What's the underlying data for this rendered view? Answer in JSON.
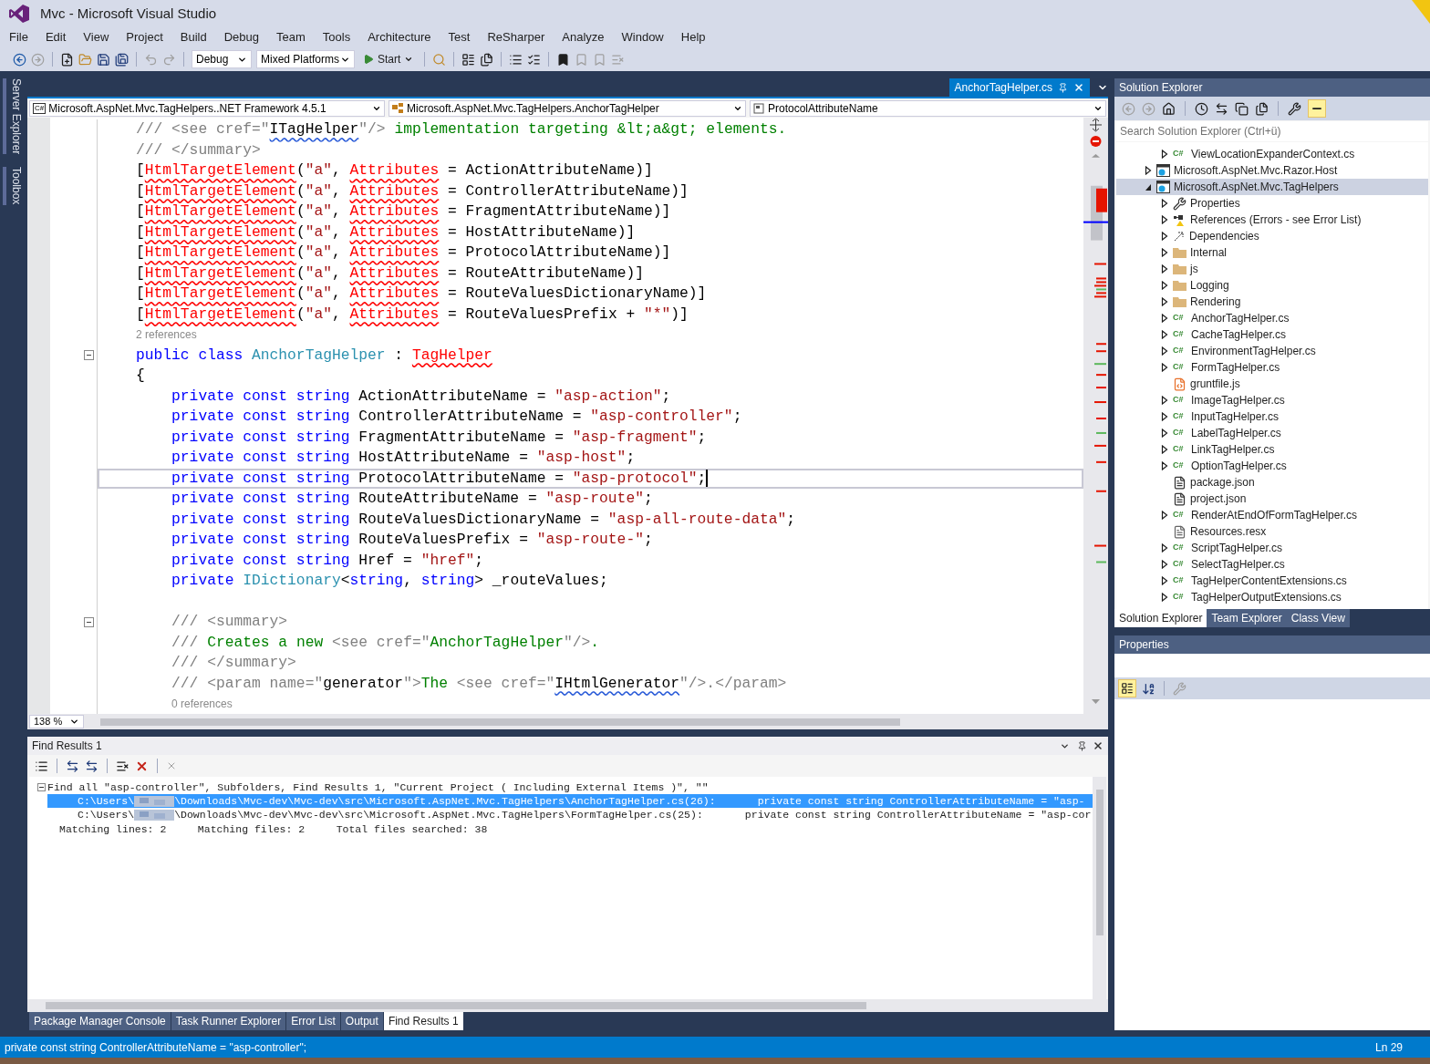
{
  "window": {
    "title": "Mvc - Microsoft Visual Studio"
  },
  "menu": [
    "File",
    "Edit",
    "View",
    "Project",
    "Build",
    "Debug",
    "Team",
    "Tools",
    "Architecture",
    "Test",
    "ReSharper",
    "Analyze",
    "Window",
    "Help"
  ],
  "toolbar": {
    "configuration": "Debug",
    "platform": "Mixed Platforms",
    "start": "Start"
  },
  "side_tabs": [
    "Server Explorer",
    "Toolbox"
  ],
  "editor": {
    "tabs": [
      {
        "label": "AnchorTagHelper.cs",
        "selected": true
      }
    ],
    "nav": {
      "badge": "C#",
      "project": "Microsoft.AspNet.Mvc.TagHelpers..NET Framework 4.5.1",
      "type": "Microsoft.AspNet.Mvc.TagHelpers.AnchorTagHelper",
      "member": "ProtocolAttributeName"
    },
    "lines": [
      {
        "current": false,
        "fold": false,
        "tokens": [
          {
            "text": "/// <see cref=\"",
            "kind": "doc"
          },
          {
            "text": "ITagHelper",
            "kind": "sq"
          },
          {
            "text": "\"/> ",
            "kind": "doc"
          },
          {
            "text": "implementation targeting &lt;a&gt; elements.",
            "kind": "cm"
          }
        ]
      },
      {
        "current": false,
        "fold": false,
        "tokens": [
          {
            "text": "/// </summary>",
            "kind": "doc"
          }
        ]
      },
      {
        "current": false,
        "fold": false,
        "tokens": [
          {
            "text": "[",
            "kind": "pl"
          },
          {
            "text": "HtmlTargetElement",
            "kind": "err"
          },
          {
            "text": "(",
            "kind": "pl"
          },
          {
            "text": "\"a\"",
            "kind": "str"
          },
          {
            "text": ", ",
            "kind": "pl"
          },
          {
            "text": "Attributes",
            "kind": "err"
          },
          {
            "text": " = ActionAttributeName)]",
            "kind": "pl"
          }
        ]
      },
      {
        "current": false,
        "fold": false,
        "tokens": [
          {
            "text": "[",
            "kind": "pl"
          },
          {
            "text": "HtmlTargetElement",
            "kind": "err"
          },
          {
            "text": "(",
            "kind": "pl"
          },
          {
            "text": "\"a\"",
            "kind": "str"
          },
          {
            "text": ", ",
            "kind": "pl"
          },
          {
            "text": "Attributes",
            "kind": "err"
          },
          {
            "text": " = ControllerAttributeName)]",
            "kind": "pl"
          }
        ]
      },
      {
        "current": false,
        "fold": false,
        "tokens": [
          {
            "text": "[",
            "kind": "pl"
          },
          {
            "text": "HtmlTargetElement",
            "kind": "err"
          },
          {
            "text": "(",
            "kind": "pl"
          },
          {
            "text": "\"a\"",
            "kind": "str"
          },
          {
            "text": ", ",
            "kind": "pl"
          },
          {
            "text": "Attributes",
            "kind": "err"
          },
          {
            "text": " = FragmentAttributeName)]",
            "kind": "pl"
          }
        ]
      },
      {
        "current": false,
        "fold": false,
        "tokens": [
          {
            "text": "[",
            "kind": "pl"
          },
          {
            "text": "HtmlTargetElement",
            "kind": "err"
          },
          {
            "text": "(",
            "kind": "pl"
          },
          {
            "text": "\"a\"",
            "kind": "str"
          },
          {
            "text": ", ",
            "kind": "pl"
          },
          {
            "text": "Attributes",
            "kind": "err"
          },
          {
            "text": " = HostAttributeName)]",
            "kind": "pl"
          }
        ]
      },
      {
        "current": false,
        "fold": false,
        "tokens": [
          {
            "text": "[",
            "kind": "pl"
          },
          {
            "text": "HtmlTargetElement",
            "kind": "err"
          },
          {
            "text": "(",
            "kind": "pl"
          },
          {
            "text": "\"a\"",
            "kind": "str"
          },
          {
            "text": ", ",
            "kind": "pl"
          },
          {
            "text": "Attributes",
            "kind": "err"
          },
          {
            "text": " = ProtocolAttributeName)]",
            "kind": "pl"
          }
        ]
      },
      {
        "current": false,
        "fold": false,
        "tokens": [
          {
            "text": "[",
            "kind": "pl"
          },
          {
            "text": "HtmlTargetElement",
            "kind": "err"
          },
          {
            "text": "(",
            "kind": "pl"
          },
          {
            "text": "\"a\"",
            "kind": "str"
          },
          {
            "text": ", ",
            "kind": "pl"
          },
          {
            "text": "Attributes",
            "kind": "err"
          },
          {
            "text": " = RouteAttributeName)]",
            "kind": "pl"
          }
        ]
      },
      {
        "current": false,
        "fold": false,
        "tokens": [
          {
            "text": "[",
            "kind": "pl"
          },
          {
            "text": "HtmlTargetElement",
            "kind": "err"
          },
          {
            "text": "(",
            "kind": "pl"
          },
          {
            "text": "\"a\"",
            "kind": "str"
          },
          {
            "text": ", ",
            "kind": "pl"
          },
          {
            "text": "Attributes",
            "kind": "err"
          },
          {
            "text": " = RouteValuesDictionaryName)]",
            "kind": "pl"
          }
        ]
      },
      {
        "current": false,
        "fold": false,
        "tokens": [
          {
            "text": "[",
            "kind": "pl"
          },
          {
            "text": "HtmlTargetElement",
            "kind": "err"
          },
          {
            "text": "(",
            "kind": "pl"
          },
          {
            "text": "\"a\"",
            "kind": "str"
          },
          {
            "text": ", ",
            "kind": "pl"
          },
          {
            "text": "Attributes",
            "kind": "err"
          },
          {
            "text": " = RouteValuesPrefix + ",
            "kind": "pl"
          },
          {
            "text": "\"*\"",
            "kind": "str"
          },
          {
            "text": ")]",
            "kind": "pl"
          }
        ]
      },
      {
        "current": false,
        "fold": false,
        "tokens": [
          {
            "text": "2 references",
            "kind": "lens"
          }
        ]
      },
      {
        "current": false,
        "fold": true,
        "tokens": [
          {
            "text": "public class ",
            "kind": "kw"
          },
          {
            "text": "AnchorTagHelper",
            "kind": "type"
          },
          {
            "text": " : ",
            "kind": "pl"
          },
          {
            "text": "TagHelper",
            "kind": "err"
          }
        ]
      },
      {
        "current": false,
        "fold": false,
        "tokens": [
          {
            "text": "{",
            "kind": "pl"
          }
        ]
      },
      {
        "current": false,
        "fold": false,
        "tokens": [
          {
            "text": "    private const string",
            "kind": "kw"
          },
          {
            "text": " ActionAttributeName = ",
            "kind": "pl"
          },
          {
            "text": "\"asp-action\"",
            "kind": "str"
          },
          {
            "text": ";",
            "kind": "pl"
          }
        ]
      },
      {
        "current": false,
        "fold": false,
        "tokens": [
          {
            "text": "    private const string",
            "kind": "kw"
          },
          {
            "text": " ControllerAttributeName = ",
            "kind": "pl"
          },
          {
            "text": "\"asp-controller\"",
            "kind": "str"
          },
          {
            "text": ";",
            "kind": "pl"
          }
        ]
      },
      {
        "current": false,
        "fold": false,
        "tokens": [
          {
            "text": "    private const string",
            "kind": "kw"
          },
          {
            "text": " FragmentAttributeName = ",
            "kind": "pl"
          },
          {
            "text": "\"asp-fragment\"",
            "kind": "str"
          },
          {
            "text": ";",
            "kind": "pl"
          }
        ]
      },
      {
        "current": false,
        "fold": false,
        "tokens": [
          {
            "text": "    private const string",
            "kind": "kw"
          },
          {
            "text": " HostAttributeName = ",
            "kind": "pl"
          },
          {
            "text": "\"asp-host\"",
            "kind": "str"
          },
          {
            "text": ";",
            "kind": "pl"
          }
        ]
      },
      {
        "current": true,
        "fold": false,
        "tokens": [
          {
            "text": "    private const string",
            "kind": "kw"
          },
          {
            "text": " ProtocolAttributeName = ",
            "kind": "pl"
          },
          {
            "text": "\"asp-protocol\"",
            "kind": "str"
          },
          {
            "text": ";",
            "kind": "pl"
          }
        ]
      },
      {
        "current": false,
        "fold": false,
        "tokens": [
          {
            "text": "    private const string",
            "kind": "kw"
          },
          {
            "text": " RouteAttributeName = ",
            "kind": "pl"
          },
          {
            "text": "\"asp-route\"",
            "kind": "str"
          },
          {
            "text": ";",
            "kind": "pl"
          }
        ]
      },
      {
        "current": false,
        "fold": false,
        "tokens": [
          {
            "text": "    private const string",
            "kind": "kw"
          },
          {
            "text": " RouteValuesDictionaryName = ",
            "kind": "pl"
          },
          {
            "text": "\"asp-all-route-data\"",
            "kind": "str"
          },
          {
            "text": ";",
            "kind": "pl"
          }
        ]
      },
      {
        "current": false,
        "fold": false,
        "tokens": [
          {
            "text": "    private const string",
            "kind": "kw"
          },
          {
            "text": " RouteValuesPrefix = ",
            "kind": "pl"
          },
          {
            "text": "\"asp-route-\"",
            "kind": "str"
          },
          {
            "text": ";",
            "kind": "pl"
          }
        ]
      },
      {
        "current": false,
        "fold": false,
        "tokens": [
          {
            "text": "    private const string",
            "kind": "kw"
          },
          {
            "text": " Href = ",
            "kind": "pl"
          },
          {
            "text": "\"href\"",
            "kind": "str"
          },
          {
            "text": ";",
            "kind": "pl"
          }
        ]
      },
      {
        "current": false,
        "fold": false,
        "tokens": [
          {
            "text": "    private ",
            "kind": "kw"
          },
          {
            "text": "IDictionary",
            "kind": "type"
          },
          {
            "text": "<",
            "kind": "pl"
          },
          {
            "text": "string",
            "kind": "kw"
          },
          {
            "text": ", ",
            "kind": "pl"
          },
          {
            "text": "string",
            "kind": "kw"
          },
          {
            "text": "> _routeValues;",
            "kind": "pl"
          }
        ]
      },
      {
        "current": false,
        "fold": false
      },
      {
        "current": false,
        "fold": true,
        "tokens": [
          {
            "text": "    /// <summary>",
            "kind": "doc"
          }
        ]
      },
      {
        "current": false,
        "fold": false,
        "tokens": [
          {
            "text": "    /// ",
            "kind": "doc"
          },
          {
            "text": "Creates a new ",
            "kind": "cm"
          },
          {
            "text": "<see cref=\"",
            "kind": "doc"
          },
          {
            "text": "AnchorTagHelper",
            "kind": "cm"
          },
          {
            "text": "\"/>",
            "kind": "doc"
          },
          {
            "text": ".",
            "kind": "cm"
          }
        ]
      },
      {
        "current": false,
        "fold": false,
        "tokens": [
          {
            "text": "    /// </summary>",
            "kind": "doc"
          }
        ]
      },
      {
        "current": false,
        "fold": false,
        "tokens": [
          {
            "text": "    /// <param name=\"",
            "kind": "doc"
          },
          {
            "text": "generator",
            "kind": "pl"
          },
          {
            "text": "\">",
            "kind": "doc"
          },
          {
            "text": "The ",
            "kind": "cm"
          },
          {
            "text": "<see cref=\"",
            "kind": "doc"
          },
          {
            "text": "IHtmlGenerator",
            "kind": "sq"
          },
          {
            "text": "\"/>",
            "kind": "doc"
          },
          {
            "text": ".</param>",
            "kind": "doc"
          }
        ]
      },
      {
        "current": false,
        "fold": false,
        "tokens": [
          {
            "text": "0 references",
            "kind": "lens_indented"
          }
        ]
      }
    ],
    "zoom": "138 %"
  },
  "find_results": {
    "title": "Find Results 1",
    "expanded": true,
    "header": "Find all \"asp-controller\", Subfolders, Find Results 1, \"Current Project ( Including External Items )\", \"\"",
    "results": [
      {
        "path_start": "C:\\Users\\",
        "path_end": "\\Downloads\\Mvc-dev\\Mvc-dev\\src\\Microsoft.AspNet.Mvc.TagHelpers\\AnchorTagHelper.cs(26):",
        "code": "private const string ControllerAttributeName = \"asp-",
        "selected": true
      },
      {
        "path_start": "C:\\Users\\",
        "path_end": "\\Downloads\\Mvc-dev\\Mvc-dev\\src\\Microsoft.AspNet.Mvc.TagHelpers\\FormTagHelper.cs(25):",
        "code": "private const string ControllerAttributeName = \"asp-cor",
        "selected": false
      }
    ],
    "summary": "Matching lines: 2     Matching files: 2     Total files searched: 38"
  },
  "bottom_tabs": [
    {
      "label": "Package Manager Console",
      "selected": false
    },
    {
      "label": "Task Runner Explorer",
      "selected": false
    },
    {
      "label": "Error List",
      "selected": false
    },
    {
      "label": "Output",
      "selected": false
    },
    {
      "label": "Find Results 1",
      "selected": true
    }
  ],
  "solution_explorer": {
    "title": "Solution Explorer",
    "search": {
      "placeholder": "Search Solution Explorer (Ctrl+ü)"
    },
    "clipped_children": [
      {
        "label": "ViewLocationExpanderContext.cs",
        "kind": "cs",
        "badge": "C#",
        "expandable": true,
        "selected": false
      }
    ],
    "items": [
      {
        "label": "Microsoft.AspNet.Mvc.Razor.Host",
        "kind": "project",
        "expandable": true,
        "expanded": false,
        "selected": false
      },
      {
        "label": "Microsoft.AspNet.Mvc.TagHelpers",
        "kind": "project",
        "expandable": true,
        "expanded": true,
        "selected": true,
        "children": [
          {
            "label": "Properties",
            "kind": "properties",
            "expandable": true,
            "selected": false
          },
          {
            "label": "References (Errors - see Error List)",
            "kind": "references",
            "expandable": true,
            "selected": false
          },
          {
            "label": "Dependencies",
            "kind": "dependencies",
            "expandable": true,
            "selected": false
          },
          {
            "label": "Internal",
            "kind": "folder",
            "expandable": true,
            "selected": false
          },
          {
            "label": "js",
            "kind": "folder",
            "expandable": true,
            "selected": false
          },
          {
            "label": "Logging",
            "kind": "folder",
            "expandable": true,
            "selected": false
          },
          {
            "label": "Rendering",
            "kind": "folder",
            "expandable": true,
            "selected": false
          },
          {
            "label": "AnchorTagHelper.cs",
            "kind": "cs",
            "badge": "C#",
            "expandable": true,
            "selected": false
          },
          {
            "label": "CacheTagHelper.cs",
            "kind": "cs",
            "badge": "C#",
            "expandable": true,
            "selected": false
          },
          {
            "label": "EnvironmentTagHelper.cs",
            "kind": "cs",
            "badge": "C#",
            "expandable": true,
            "selected": false
          },
          {
            "label": "FormTagHelper.cs",
            "kind": "cs",
            "badge": "C#",
            "expandable": true,
            "selected": false
          },
          {
            "label": "gruntfile.js",
            "kind": "js",
            "expandable": false,
            "selected": false
          },
          {
            "label": "ImageTagHelper.cs",
            "kind": "cs",
            "badge": "C#",
            "expandable": true,
            "selected": false
          },
          {
            "label": "InputTagHelper.cs",
            "kind": "cs",
            "badge": "C#",
            "expandable": true,
            "selected": false
          },
          {
            "label": "LabelTagHelper.cs",
            "kind": "cs",
            "badge": "C#",
            "expandable": true,
            "selected": false
          },
          {
            "label": "LinkTagHelper.cs",
            "kind": "cs",
            "badge": "C#",
            "expandable": true,
            "selected": false
          },
          {
            "label": "OptionTagHelper.cs",
            "kind": "cs",
            "badge": "C#",
            "expandable": true,
            "selected": false
          },
          {
            "label": "package.json",
            "kind": "json",
            "expandable": false,
            "selected": false
          },
          {
            "label": "project.json",
            "kind": "json",
            "expandable": false,
            "selected": false
          },
          {
            "label": "RenderAtEndOfFormTagHelper.cs",
            "kind": "cs",
            "badge": "C#",
            "expandable": true,
            "selected": false
          },
          {
            "label": "Resources.resx",
            "kind": "resx",
            "expandable": false,
            "selected": false
          },
          {
            "label": "ScriptTagHelper.cs",
            "kind": "cs",
            "badge": "C#",
            "expandable": true,
            "selected": false
          },
          {
            "label": "SelectTagHelper.cs",
            "kind": "cs",
            "badge": "C#",
            "expandable": true,
            "selected": false
          },
          {
            "label": "TagHelperContentExtensions.cs",
            "kind": "cs",
            "badge": "C#",
            "expandable": true,
            "selected": false
          },
          {
            "label": "TagHelperOutputExtensions.cs",
            "kind": "cs",
            "badge": "C#",
            "expandable": true,
            "selected": false
          }
        ]
      }
    ],
    "tabs": [
      {
        "label": "Solution Explorer",
        "selected": true
      },
      {
        "label": "Team Explorer",
        "selected": false
      },
      {
        "label": "Class View",
        "selected": false
      }
    ]
  },
  "properties": {
    "title": "Properties"
  },
  "status_bar": {
    "message": "private const string ControllerAttributeName = \"asp-controller\";",
    "position": "Ln 29"
  }
}
